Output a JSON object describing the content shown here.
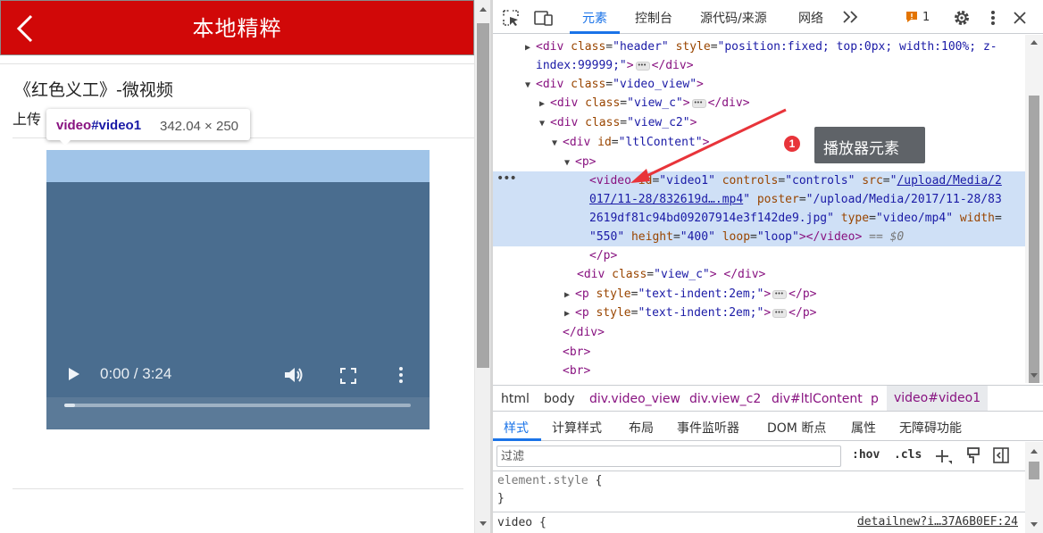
{
  "page": {
    "header_title": "本地精粹",
    "article_title": "《红色义工》-微视频",
    "upload_text": "上传",
    "tooltip": {
      "tag": "video",
      "id": "#video1",
      "size": "342.04 × 250"
    },
    "video": {
      "time": "0:00 / 3:24",
      "progress": 0.03
    },
    "colors": {
      "header": "#d10808",
      "video_bg": "#4a6d8f",
      "highlight_margin": "#a0c4e8"
    }
  },
  "devtools": {
    "tabs": [
      "元素",
      "控制台",
      "源代码/来源",
      "网络"
    ],
    "active_tab": "元素",
    "issues_count": "1",
    "dom": {
      "l1": {
        "tag": "div",
        "class": "header",
        "style": "position:fixed; top:0px; width:100%; z-",
        "style_cont": "index:99999;"
      },
      "l2": {
        "tag": "div",
        "class": "video_view"
      },
      "l3": {
        "tag": "div",
        "class": "view_c"
      },
      "l4": {
        "tag": "div",
        "class": "view_c2"
      },
      "l5": {
        "tag": "div",
        "id": "ltlContent"
      },
      "l6": {
        "tag": "p"
      },
      "video": {
        "tag": "video",
        "id": "video1",
        "controls": "controls",
        "src_part1": "/upload/Media/2",
        "src_part2": "017/11-28/832619d….mp4",
        "poster_part1": "/upload/Media/2017/11-28/83",
        "poster_part2": "2619df81c94bd09207914e3f142de9.jpg",
        "type": "video/mp4",
        "width_part": "550",
        "height": "400",
        "loop": "loop",
        "dollar": "== $0"
      },
      "l8": {
        "tag": "div",
        "class": "view_c"
      },
      "l9": {
        "tag": "p",
        "style": "text-indent:2em;"
      },
      "l10": {
        "tag": "p",
        "style": "text-indent:2em;"
      },
      "l11": {
        "tag": "div"
      },
      "br": "br"
    },
    "callout": {
      "number": "1",
      "label": "播放器元素",
      "color": "#e8343a"
    },
    "breadcrumbs": [
      "html",
      "body",
      "div.video_view",
      "div.view_c2",
      "div#ltlContent",
      "p",
      "video#video1"
    ],
    "sub_tabs": [
      "样式",
      "计算样式",
      "布局",
      "事件监听器",
      "DOM 断点",
      "属性",
      "无障碍功能"
    ],
    "active_sub_tab": "样式",
    "filter_placeholder": "过滤",
    "hov": ":hov",
    "cls": ".cls",
    "styles": {
      "element_style": "element.style",
      "open": "{",
      "close": "}",
      "video_rule": "video",
      "source": "detailnew?i…37A6B0EF:24"
    }
  }
}
